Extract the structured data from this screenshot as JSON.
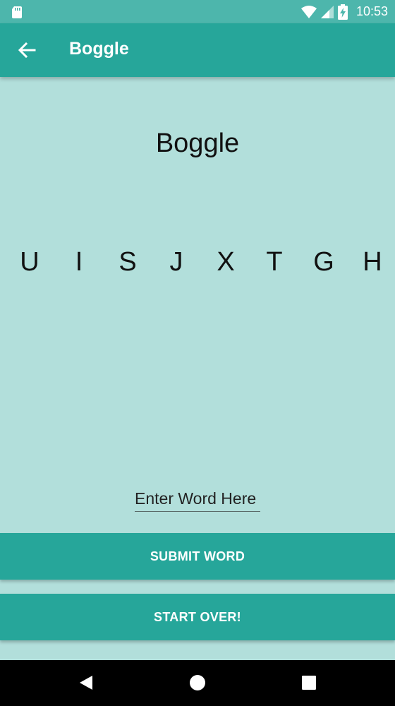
{
  "status_bar": {
    "time": "10:53",
    "icons": [
      "sd-card-icon",
      "wifi-icon",
      "signal-icon",
      "battery-charging-icon"
    ]
  },
  "app_bar": {
    "title": "Boggle",
    "back_icon": "arrow-back-icon"
  },
  "main": {
    "heading": "Boggle",
    "letters": [
      "U",
      "I",
      "S",
      "J",
      "X",
      "T",
      "G",
      "H"
    ],
    "word_input": {
      "placeholder": "Enter Word Here",
      "value": ""
    },
    "submit_label": "SUBMIT WORD",
    "start_over_label": "START OVER!"
  },
  "nav_bar": {
    "icons": [
      "back-triangle-icon",
      "home-circle-icon",
      "recents-square-icon"
    ]
  },
  "colors": {
    "status_bar": "#4db6ac",
    "app_bar": "#26a69a",
    "background": "#b2dfdb",
    "button": "#26a69a",
    "nav_bar": "#000000"
  }
}
